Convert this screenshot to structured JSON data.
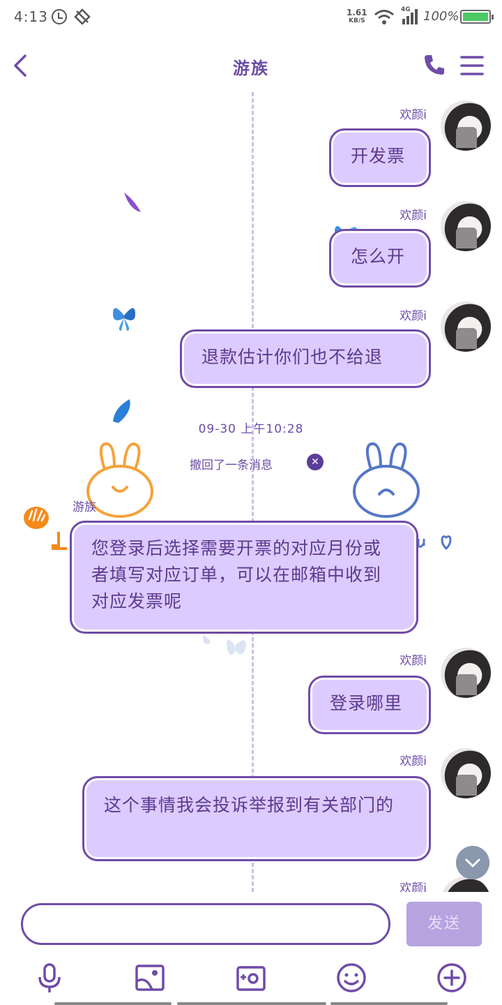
{
  "status_bar": {
    "time": "4:13",
    "net_speed": "1.61",
    "net_speed_unit": "KB/S",
    "network_type": "4G",
    "battery": "100%"
  },
  "header": {
    "title": "游族"
  },
  "me": {
    "nickname": "欢颜i"
  },
  "other": {
    "nickname": "游族"
  },
  "messages": [
    {
      "text": "开发票"
    },
    {
      "text": "怎么开"
    },
    {
      "text": "退款估计你们也不给退"
    },
    {
      "text": "您登录后选择需要开票的对应月份或者填写对应订单，可以在邮箱中收到对应发票呢"
    },
    {
      "text": "登录哪里"
    },
    {
      "text": "这个事情我会投诉举报到有关部门的"
    }
  ],
  "timestamp": "09-30 上午10:28",
  "recall_notice": "撤回了一条消息",
  "input": {
    "value": "",
    "send_label": "发送"
  },
  "colors": {
    "accent": "#6f4ca8",
    "bubble": "#dccbff",
    "send_disabled": "#b7a3e0"
  },
  "icons": [
    "voice-icon",
    "image-icon",
    "camera-icon",
    "emoji-icon",
    "plus-icon"
  ]
}
